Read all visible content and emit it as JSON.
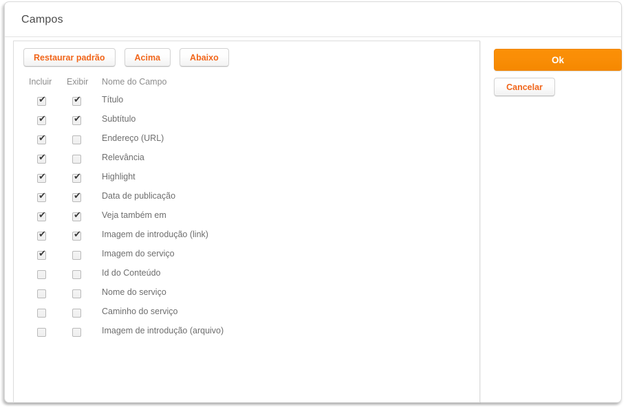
{
  "dialog": {
    "title": "Campos"
  },
  "toolbar": {
    "restore_default_label": "Restaurar padrão",
    "move_up_label": "Acima",
    "move_down_label": "Abaixo"
  },
  "table": {
    "headers": {
      "include": "Incluir",
      "display": "Exibir",
      "field_name": "Nome do Campo"
    },
    "rows": [
      {
        "name": "Título",
        "include": true,
        "display": true
      },
      {
        "name": "Subtítulo",
        "include": true,
        "display": true
      },
      {
        "name": "Endereço (URL)",
        "include": true,
        "display": false
      },
      {
        "name": "Relevância",
        "include": true,
        "display": false
      },
      {
        "name": "Highlight",
        "include": true,
        "display": true
      },
      {
        "name": "Data de publicação",
        "include": true,
        "display": true
      },
      {
        "name": "Veja também em",
        "include": true,
        "display": true
      },
      {
        "name": "Imagem de introdução (link)",
        "include": true,
        "display": true
      },
      {
        "name": "Imagem do serviço",
        "include": true,
        "display": false
      },
      {
        "name": "Id do Conteúdo",
        "include": false,
        "display": false
      },
      {
        "name": "Nome do serviço",
        "include": false,
        "display": false
      },
      {
        "name": "Caminho do serviço",
        "include": false,
        "display": false
      },
      {
        "name": "Imagem de introdução (arquivo)",
        "include": false,
        "display": false
      }
    ]
  },
  "actions": {
    "ok_label": "Ok",
    "cancel_label": "Cancelar"
  },
  "icons": {
    "checkmark": "✔"
  },
  "colors": {
    "accent_orange": "#f98d06",
    "link_orange": "#f1651a",
    "text_grey": "#6e6e6e",
    "header_grey": "#8d8d8d",
    "title_grey": "#4b4b4b",
    "border_grey": "#dcdcdc"
  }
}
